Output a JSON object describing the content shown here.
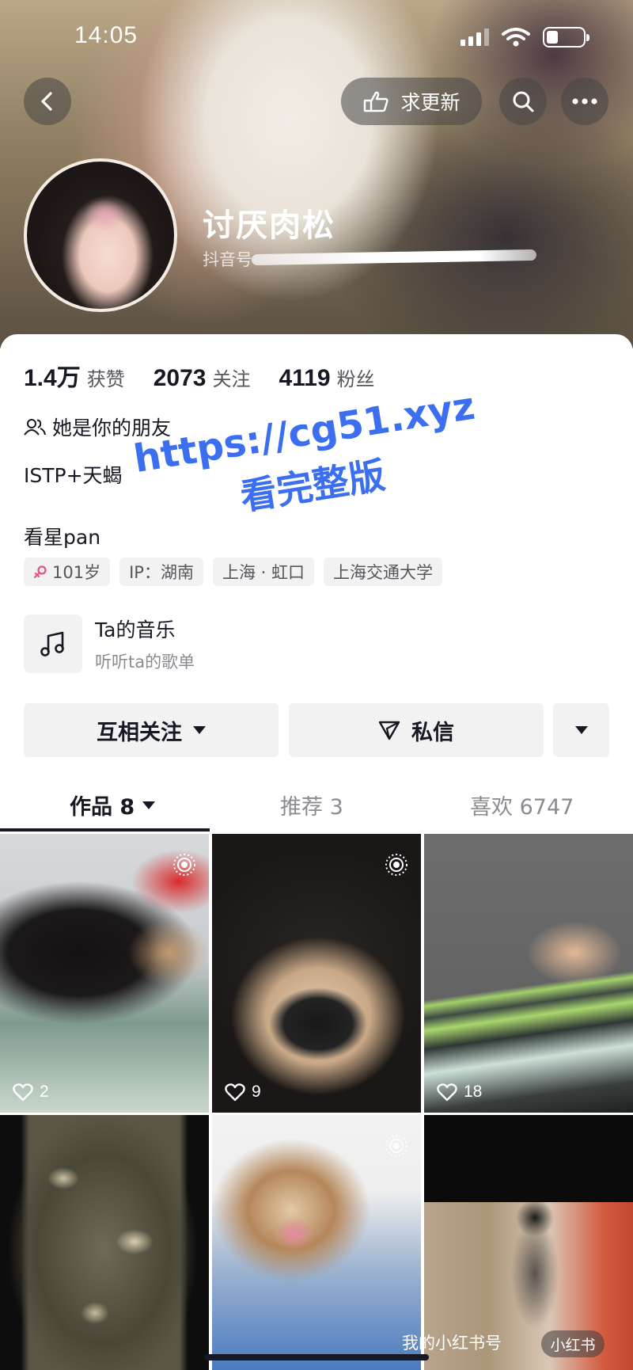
{
  "status_bar": {
    "time": "14:05"
  },
  "header": {
    "update_button": "求更新",
    "name": "讨厌肉松",
    "id_prefix": "抖音号"
  },
  "stats": [
    {
      "value": "1.4万",
      "label": "获赞"
    },
    {
      "value": "2073",
      "label": "关注"
    },
    {
      "value": "4119",
      "label": "粉丝"
    }
  ],
  "profile": {
    "friend_text": "她是你的朋友",
    "bio_line1": "ISTP+天蝎",
    "bio_line2": "看星pan",
    "tags": [
      "101岁",
      "IP：湖南",
      "上海 · 虹口",
      "上海交通大学"
    ]
  },
  "music": {
    "title": "Ta的音乐",
    "subtitle": "听听ta的歌单"
  },
  "actions": {
    "follow": "互相关注",
    "message": "私信"
  },
  "tabs": [
    {
      "label": "作品 8"
    },
    {
      "label": "推荐 3"
    },
    {
      "label": "喜欢 6747"
    }
  ],
  "videos": [
    {
      "likes": "2"
    },
    {
      "likes": "9"
    },
    {
      "likes": "18"
    }
  ],
  "overlay": {
    "xhs_badge": "小红书",
    "xhs_caption": "我的小红书号"
  },
  "watermark": {
    "line1": "https://cg51.xyz",
    "line2": "看完整版"
  },
  "colors": {
    "accent_blue": "#3b6ff0",
    "tag_bg": "#f2f2f3",
    "text_primary": "#161823"
  }
}
